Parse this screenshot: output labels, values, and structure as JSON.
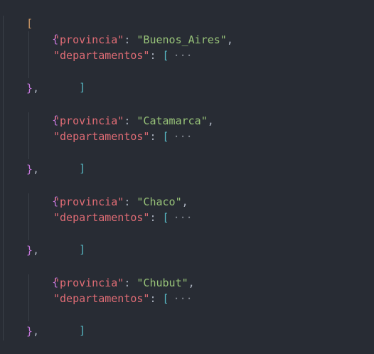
{
  "editor": {
    "open_bracket": "[",
    "items": [
      {
        "open_brace": "{",
        "key_provincia": "\"provincia\"",
        "colon1": ": ",
        "provincia": "\"Buenos_Aires\"",
        "comma1": ",",
        "key_departamentos": "\"departamentos\"",
        "colon2": ": ",
        "arr_open": "[",
        "fold": "···",
        "arr_close": "]",
        "close_brace": "}",
        "trailing_comma": ","
      },
      {
        "open_brace": "{",
        "key_provincia": "\"provincia\"",
        "colon1": ": ",
        "provincia": "\"Catamarca\"",
        "comma1": ",",
        "key_departamentos": "\"departamentos\"",
        "colon2": ": ",
        "arr_open": "[",
        "fold": "···",
        "arr_close": "]",
        "close_brace": "}",
        "trailing_comma": ","
      },
      {
        "open_brace": "{",
        "key_provincia": "\"provincia\"",
        "colon1": ": ",
        "provincia": "\"Chaco\"",
        "comma1": ",",
        "key_departamentos": "\"departamentos\"",
        "colon2": ": ",
        "arr_open": "[",
        "fold": "···",
        "arr_close": "]",
        "close_brace": "}",
        "trailing_comma": ","
      },
      {
        "open_brace": "{",
        "key_provincia": "\"provincia\"",
        "colon1": ": ",
        "provincia": "\"Chubut\"",
        "comma1": ",",
        "key_departamentos": "\"departamentos\"",
        "colon2": ": ",
        "arr_open": "[",
        "fold": "···",
        "arr_close": "]",
        "close_brace": "}",
        "trailing_comma": ","
      }
    ]
  },
  "colors": {
    "background": "#282c34",
    "key": "#e06c75",
    "string": "#98c379",
    "brace": "#c678dd",
    "array_bracket": "#56b6c2",
    "outer_bracket": "#d19a66",
    "punctuation": "#abb2bf"
  }
}
